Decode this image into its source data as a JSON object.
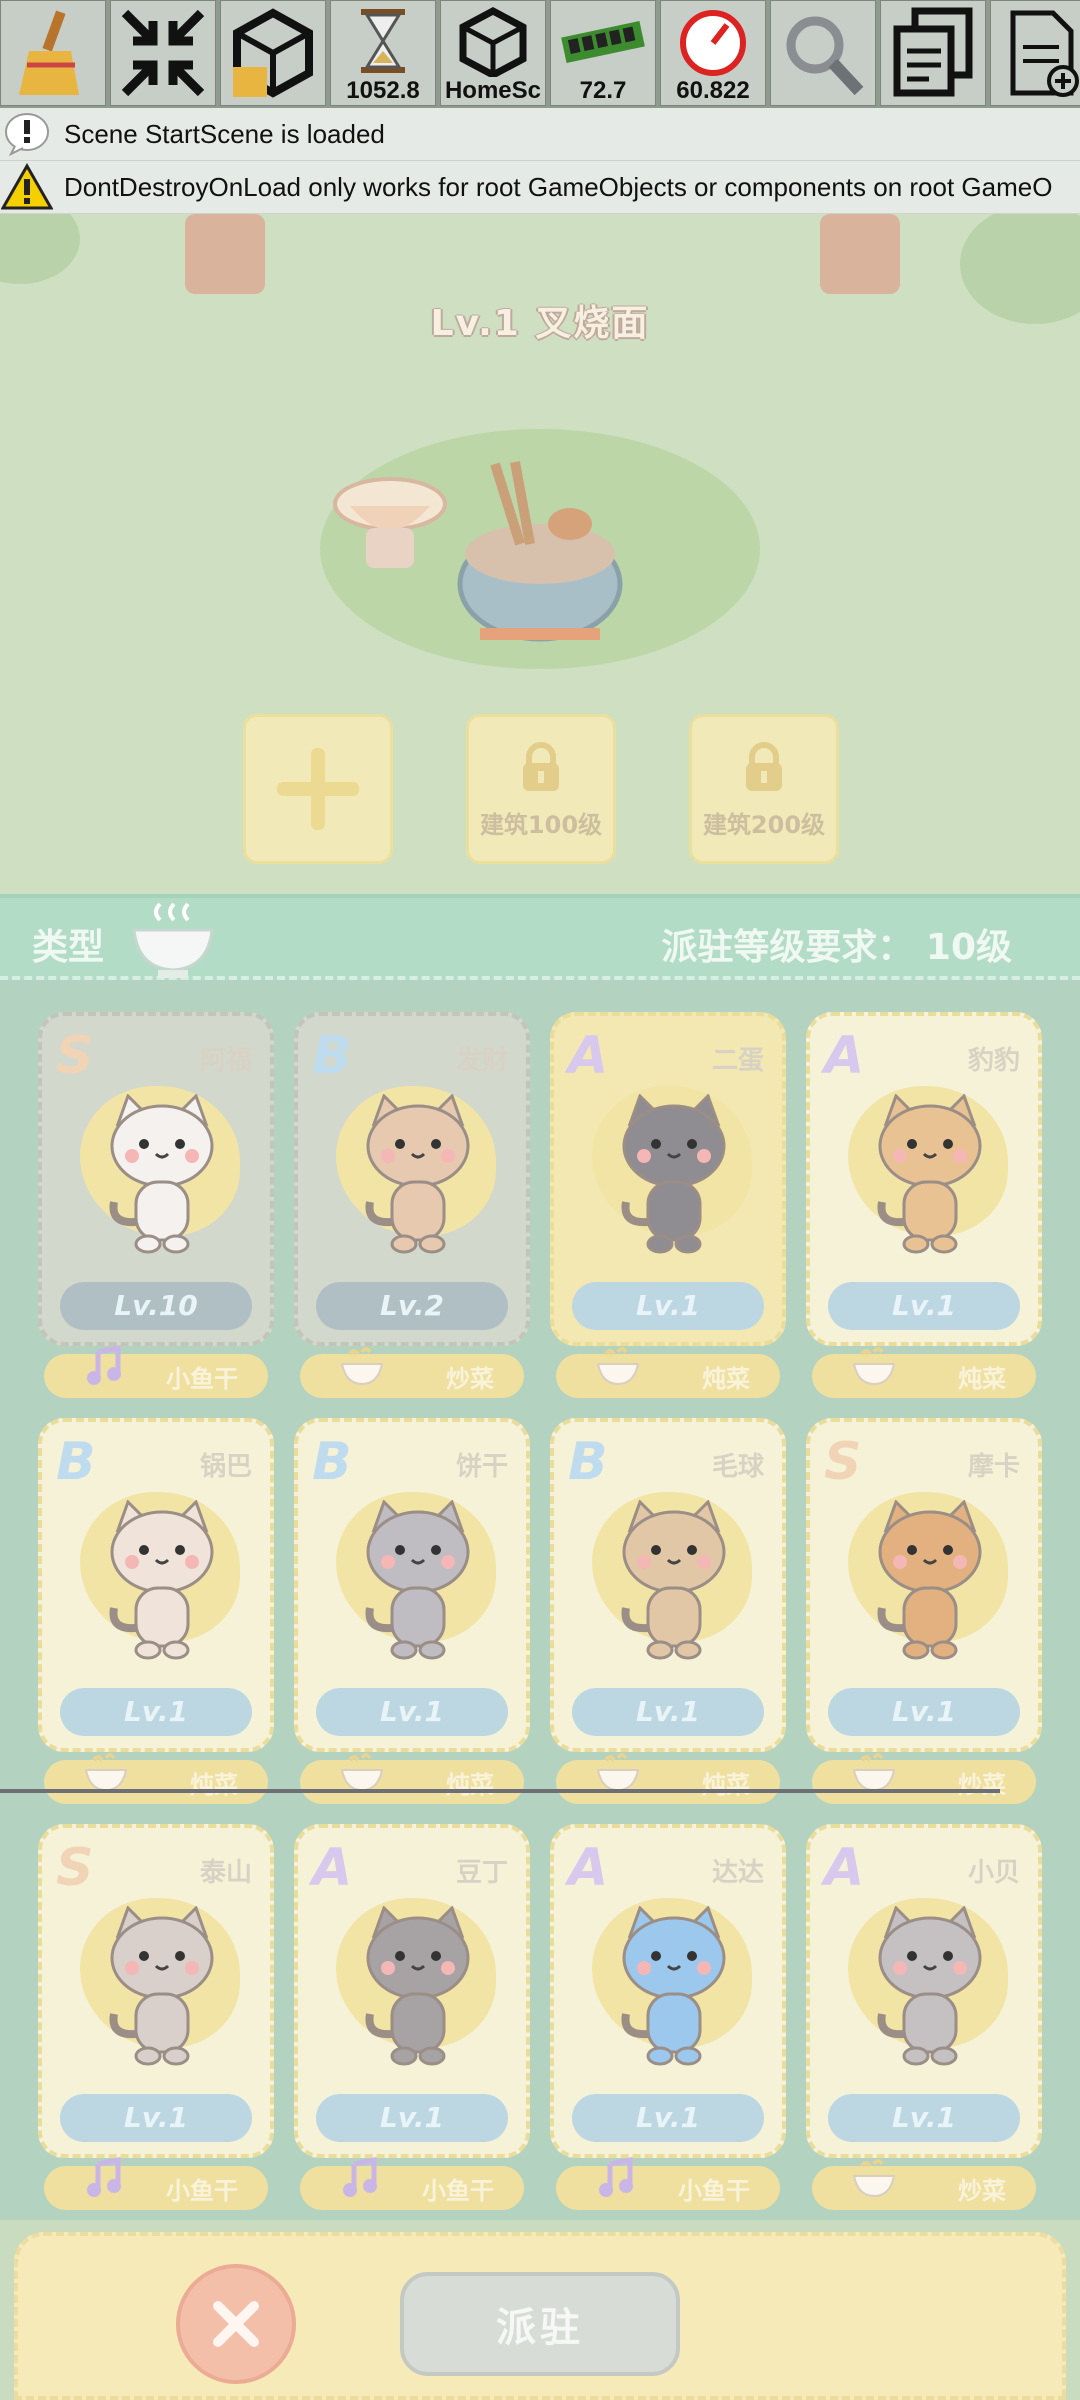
{
  "toolbar": {
    "buttons": [
      {
        "name": "broom-clear-icon",
        "value": ""
      },
      {
        "name": "collapse-arrows-icon",
        "value": ""
      },
      {
        "name": "unity-clear-icon",
        "value": ""
      },
      {
        "name": "hourglass-icon",
        "value": "1052.8"
      },
      {
        "name": "unity-scene-icon",
        "value": "HomeSc"
      },
      {
        "name": "memory-ram-icon",
        "value": "72.7"
      },
      {
        "name": "speedometer-fps-icon",
        "value": "60.822"
      },
      {
        "name": "magnifier-icon",
        "value": ""
      },
      {
        "name": "copy-pages-icon",
        "value": ""
      },
      {
        "name": "new-document-icon",
        "value": ""
      }
    ]
  },
  "logs": [
    {
      "level": "info",
      "text": "Scene StartScene is loaded"
    },
    {
      "level": "warning",
      "text": "DontDestroyOnLoad only works for root GameObjects or components on root GameO"
    }
  ],
  "scene": {
    "title": "Lv.1   叉烧面",
    "slots": [
      {
        "label": "",
        "locked": false
      },
      {
        "label": "建筑100级",
        "locked": true
      },
      {
        "label": "建筑200级",
        "locked": true
      }
    ]
  },
  "panel": {
    "type_label": "类型",
    "requirement": "派驻等级要求： 10级"
  },
  "cats": [
    {
      "grade": "S",
      "name": "阿福",
      "level": "Lv.10",
      "food": "小鱼干",
      "state": "selected"
    },
    {
      "grade": "B",
      "name": "发财",
      "level": "Lv.2",
      "food": "炒菜",
      "state": "selected"
    },
    {
      "grade": "A",
      "name": "二蛋",
      "level": "Lv.1",
      "food": "炖菜",
      "state": "highlight"
    },
    {
      "grade": "A",
      "name": "豹豹",
      "level": "Lv.1",
      "food": "炖菜",
      "state": "normal"
    },
    {
      "grade": "B",
      "name": "锅巴",
      "level": "Lv.1",
      "food": "炖菜",
      "state": "normal"
    },
    {
      "grade": "B",
      "name": "饼干",
      "level": "Lv.1",
      "food": "炖菜",
      "state": "normal"
    },
    {
      "grade": "B",
      "name": "毛球",
      "level": "Lv.1",
      "food": "炖菜",
      "state": "normal"
    },
    {
      "grade": "S",
      "name": "摩卡",
      "level": "Lv.1",
      "food": "炒菜",
      "state": "normal"
    },
    {
      "grade": "S",
      "name": "泰山",
      "level": "Lv.1",
      "food": "小鱼干",
      "state": "normal"
    },
    {
      "grade": "A",
      "name": "豆丁",
      "level": "Lv.1",
      "food": "小鱼干",
      "state": "normal"
    },
    {
      "grade": "A",
      "name": "达达",
      "level": "Lv.1",
      "food": "小鱼干",
      "state": "normal"
    },
    {
      "grade": "A",
      "name": "小贝",
      "level": "Lv.1",
      "food": "炒菜",
      "state": "normal"
    }
  ],
  "grade_colors": {
    "S": "#f1d3b6",
    "A": "#d8c8ee",
    "B": "#bfdcef"
  },
  "cat_colors": [
    "#f4f1ee",
    "#e6c9ae",
    "#8f8c92",
    "#e8c293",
    "#f0e4da",
    "#bfbcc2",
    "#e2c7a6",
    "#e2b17f",
    "#d9d0cc",
    "#a7a3a5",
    "#9cc8ee",
    "#c5c1c3"
  ],
  "bottom": {
    "deploy_label": "派驻"
  }
}
